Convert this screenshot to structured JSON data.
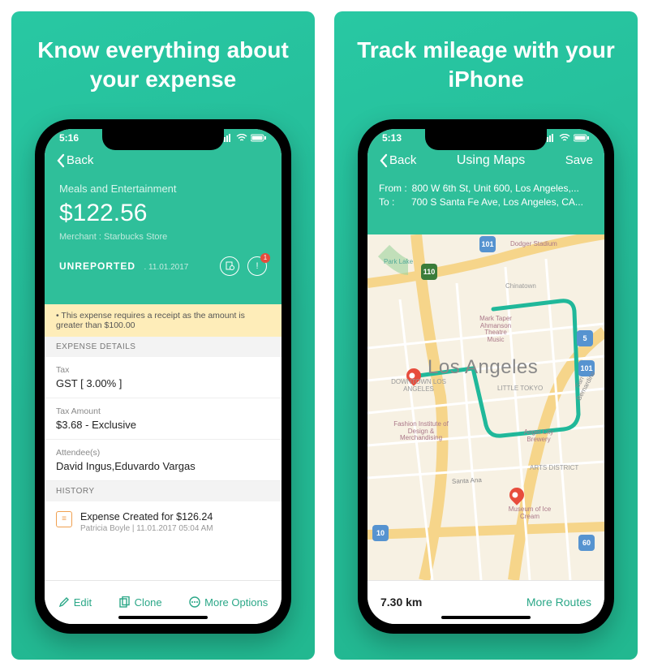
{
  "panel1": {
    "headline": "Know everything about your expense",
    "status_time": "5:16",
    "back": "Back",
    "category": "Meals and Entertainment",
    "amount": "$122.56",
    "merchant": "Merchant : Starbucks Store",
    "status_label": "UNREPORTED",
    "status_date": "11.01.2017",
    "alert_badge": "1",
    "warning": "This expense requires a receipt as the amount is greater than $100.00",
    "sec_details": "EXPENSE DETAILS",
    "tax_label": "Tax",
    "tax_value": "GST [ 3.00% ]",
    "taxamt_label": "Tax Amount",
    "taxamt_value": "$3.68 - Exclusive",
    "att_label": "Attendee(s)",
    "att_value": "David Ingus,Eduvardo Vargas",
    "sec_history": "HISTORY",
    "hist_title": "Expense Created for $126.24",
    "hist_sub": "Patricia Boyle | 11.01.2017 05:04 AM",
    "toolbar": {
      "edit": "Edit",
      "clone": "Clone",
      "more": "More Options"
    }
  },
  "panel2": {
    "headline": "Track mileage with your iPhone",
    "status_time": "5:13",
    "back": "Back",
    "title": "Using Maps",
    "save": "Save",
    "from_label": "From :",
    "from_value": "800 W 6th St, Unit 600, Los Angeles,...",
    "to_label": "To     :",
    "to_value": "700 S Santa Fe Ave, Los Angeles, CA...",
    "city": "Los Angeles",
    "distance": "7.30 km",
    "more_routes": "More Routes",
    "poi": {
      "dodger": "Dodger Stadium",
      "park": "Park Lake",
      "china": "Chinatown",
      "taper": "Mark Taper",
      "ahmanson": "Ahmanson Theatre",
      "music": "Music",
      "downtown": "DOWNTOWN LOS ANGELES",
      "tokyo": "LITTLE TOKYO",
      "bernardino": "San Bernardino",
      "fidm": "Fashion Institute of Design & Merchandising",
      "angel": "Angel City Brewery",
      "arts": "ARTS DISTRICT",
      "santaana": "Santa Ana",
      "museum": "Museum of Ice Cream"
    },
    "hwy": {
      "a": "101",
      "b": "110",
      "c": "5",
      "d": "10",
      "e": "60",
      "f": "101"
    }
  }
}
